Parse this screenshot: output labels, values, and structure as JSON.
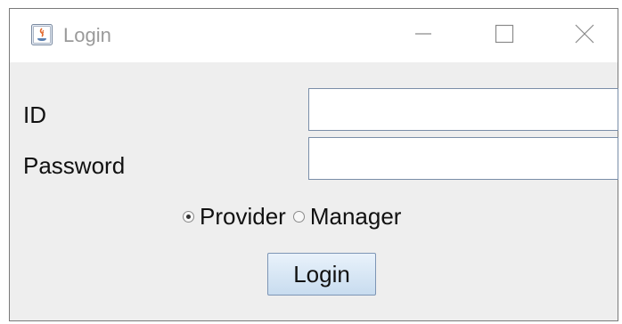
{
  "window": {
    "title": "Login",
    "app_icon": "java-icon",
    "controls": {
      "minimize": "minimize-icon",
      "maximize": "maximize-icon",
      "close": "close-icon"
    }
  },
  "form": {
    "id_label": "ID",
    "id_value": "",
    "password_label": "Password",
    "password_value": "",
    "role_options": [
      {
        "label": "Provider",
        "checked": true
      },
      {
        "label": "Manager",
        "checked": false
      }
    ],
    "submit_label": "Login"
  }
}
